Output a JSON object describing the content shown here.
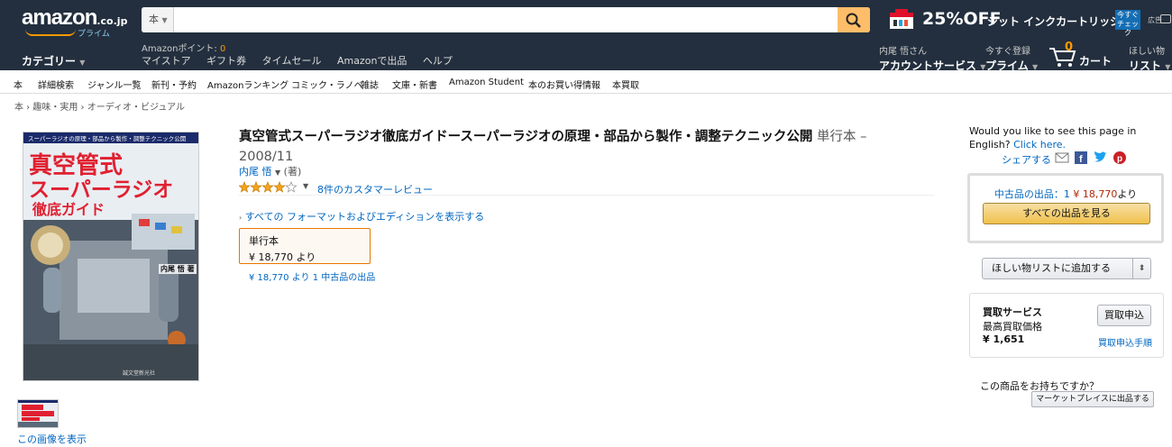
{
  "header": {
    "logo_text": "amazon",
    "logo_tld": ".co.jp",
    "logo_prime": "プライム",
    "search_scope": "本",
    "search_value": "",
    "promo_percent": "25%OFF",
    "promo_text": "ジット インクカートリッジ",
    "promo_check": "今すぐ チェック",
    "ad_label": "広告",
    "points_label": "Amazonポイント: ",
    "points_value": "0",
    "category_label": "カテゴリー",
    "subnav": [
      "マイストア",
      "ギフト券",
      "タイムセール",
      "Amazonで出品",
      "ヘルプ"
    ],
    "account_small": "内尾 悟さん",
    "account_big": "アカウントサービス",
    "prime_small": "今すぐ登録",
    "prime_big": "プライム",
    "cart_count": "0",
    "cart_label": "カート",
    "wishlist_small": "ほしい物",
    "wishlist_big": "リスト"
  },
  "secondary_nav": [
    "本",
    "詳細検索",
    "ジャンル一覧",
    "新刊・予約",
    "Amazonランキング",
    "コミック・ラノベ",
    "雑誌",
    "文庫・新書",
    "Amazon Student",
    "本のお買い得情報",
    "本買取"
  ],
  "breadcrumb": "本 › 趣味・実用 › オーディオ・ビジュアル",
  "cover": {
    "top_strip": "スーパーラジオの原理・部品から製作・調整テクニック公開",
    "line1": "真空管式",
    "line2": "スーパーラジオ",
    "line3": "徹底ガイド",
    "author": "内尾 悟 著",
    "publisher": "誠文堂新光社"
  },
  "thumb_link": "この画像を表示",
  "product": {
    "title": "真空管式スーパーラジオ徹底ガイドースーパーラジオの原理・部品から製作・調整テクニック公開",
    "format_suffix": " 単行本 –",
    "date": "2008/11",
    "author": "内尾 悟",
    "author_role": "(著)",
    "rating": 4,
    "reviews": "8件のカスタマーレビュー",
    "all_editions": "すべての フォーマットおよびエディションを表示する",
    "format_label": "単行本",
    "format_price": "¥ 18,770 より",
    "used_line": "¥ 18,770 より 1 中古品の出品"
  },
  "sidebar": {
    "english_prompt": "Would you like to see this page in English?",
    "english_link": "Click here.",
    "share_label": "シェアする",
    "used_label": "中古品の出品：1 ",
    "used_price": "¥ 18,770",
    "used_suffix": "より",
    "all_offers_button": "すべての出品を見る",
    "wishlist_button": "ほしい物リストに追加する",
    "tradein_heading": "買取サービス",
    "tradein_max": "最高買取価格",
    "tradein_value": "¥ 1,651",
    "tradein_button": "買取申込",
    "tradein_link": "買取申込手順",
    "own_question": "この商品をお持ちですか？",
    "marketplace_button": "マーケットプレイスに出品する"
  },
  "colors": {
    "header_bg": "#232f3e",
    "accent_orange": "#f90",
    "link_blue": "#0066c0",
    "price_red": "#b12704",
    "star_gold": "#f4a41c"
  }
}
